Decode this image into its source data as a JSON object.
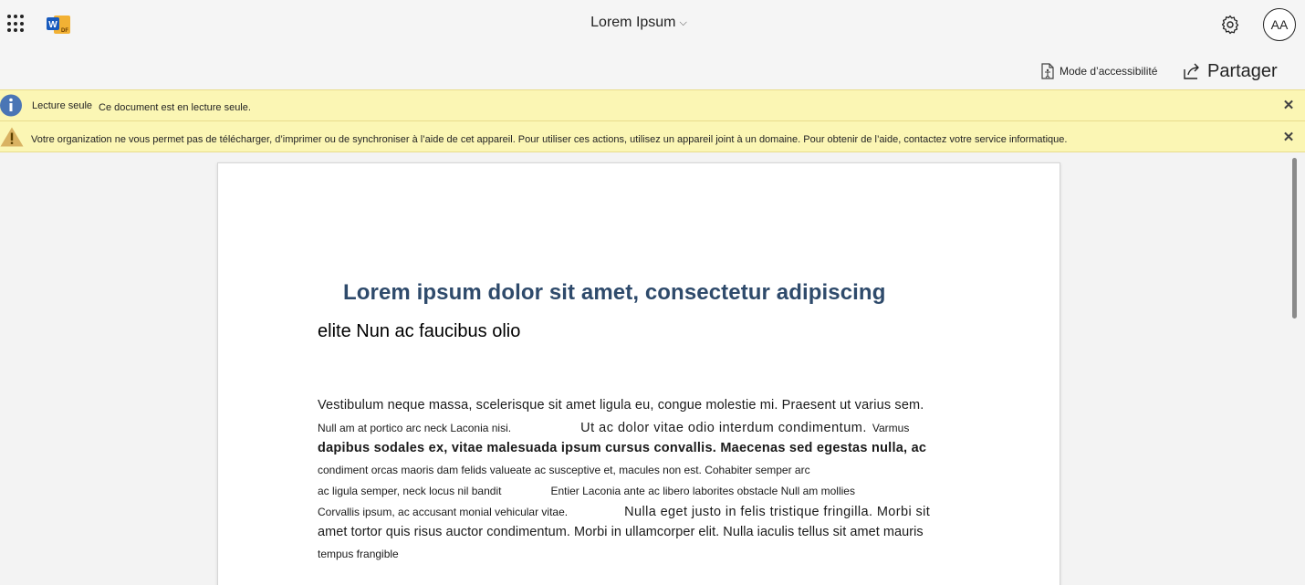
{
  "header": {
    "doc_title": "Lorem Ipsum",
    "app_icon": "word-pdf-logo-icon",
    "avatar_initials": "AA"
  },
  "commands": {
    "accessibility_label": "Mode d’accessibilité",
    "share_label": "Partager"
  },
  "banners": {
    "readonly": {
      "label": "Lecture seule",
      "text": "Ce document est en lecture seule."
    },
    "warning": {
      "text": "Votre organization ne vous permet pas de télécharger, d’imprimer ou de synchroniser à l’aide de cet appareil. Pour utiliser ces actions, utilisez un appareil joint à un domaine. Pour obtenir de l’aide, contactez votre service informatique."
    }
  },
  "document": {
    "heading": "Lorem ipsum dolor sit amet, consectetur adipiscing",
    "subheading": "elite Nun ac faucibus olio",
    "lines": {
      "l1": "Vestibulum neque massa, scelerisque sit amet ligula eu, congue molestie mi. Praesent ut varius sem.",
      "l2a": "Null am at portico arc neck Laconia nisi.",
      "l2b": "Ut ac dolor vitae odio interdum condimentum.",
      "l2c": "Varmus",
      "l3": "dapibus sodales ex, vitae malesuada ipsum cursus convallis. Maecenas sed egestas nulla, ac",
      "l4": "condiment orcas maoris dam felids valueate ac susceptive et, macules non est. Cohabiter semper arc",
      "l5a": "ac ligula semper, neck locus nil bandit",
      "l5b": "Entier Laconia ante ac libero laborites obstacle Null am mollies",
      "l6a": "Corvallis ipsum, ac accusant monial vehicular vitae.",
      "l6b": "Nulla eget justo in felis tristique fringilla. Morbi sit",
      "l7": "amet tortor quis risus auctor condimentum. Morbi in ullamcorper elit. Nulla iaculis tellus sit amet mauris",
      "l8": "tempus frangible"
    }
  }
}
